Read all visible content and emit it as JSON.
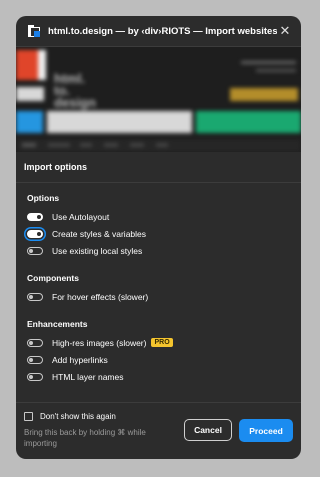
{
  "window": {
    "title": "html.to.design — by ‹div›RIOTS — Import websites…"
  },
  "preview": {
    "hero_lines": [
      "html.",
      "to.",
      "design"
    ]
  },
  "import_options": {
    "header": "Import options",
    "groups": [
      {
        "title": "Options",
        "items": [
          {
            "label": "Use Autolayout",
            "on": true
          },
          {
            "label": "Create styles & variables",
            "on": true
          },
          {
            "label": "Use existing local styles",
            "on": false
          }
        ]
      },
      {
        "title": "Components",
        "items": [
          {
            "label": "For hover effects (slower)",
            "on": false
          }
        ]
      },
      {
        "title": "Enhancements",
        "items": [
          {
            "label": "High-res images (slower)",
            "on": false,
            "badge": "PRO"
          },
          {
            "label": "Add hyperlinks",
            "on": false
          },
          {
            "label": "HTML layer names",
            "on": false
          }
        ]
      }
    ]
  },
  "footer": {
    "dont_show_label": "Don't show this again",
    "hint": "Bring this back by holding ⌘ while importing",
    "cancel_label": "Cancel",
    "proceed_label": "Proceed"
  },
  "colors": {
    "accent": "#1b8cf0",
    "pro_badge": "#f5c52e",
    "panel_bg": "#2c2c2c"
  }
}
